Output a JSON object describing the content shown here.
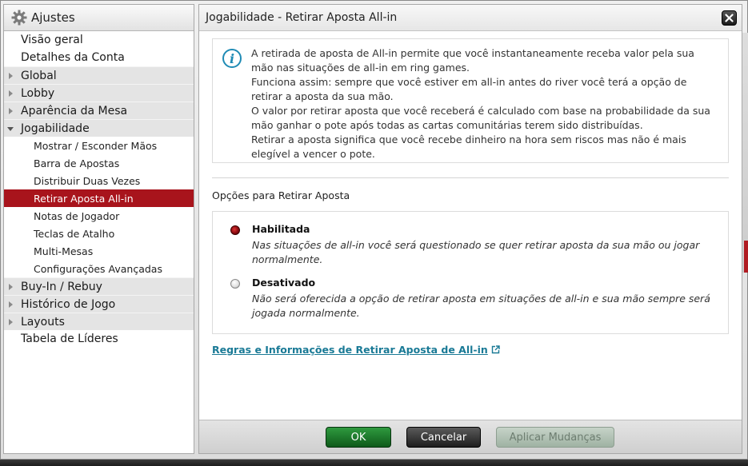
{
  "sidebar": {
    "title": "Ajustes",
    "items": [
      {
        "label": "Visão geral"
      },
      {
        "label": "Detalhes da Conta"
      },
      {
        "label": "Global"
      },
      {
        "label": "Lobby"
      },
      {
        "label": "Aparência da Mesa"
      },
      {
        "label": "Jogabilidade"
      },
      {
        "label": "Mostrar / Esconder Mãos"
      },
      {
        "label": "Barra de Apostas"
      },
      {
        "label": "Distribuir Duas Vezes"
      },
      {
        "label": "Retirar Aposta All-in"
      },
      {
        "label": "Notas de Jogador"
      },
      {
        "label": "Teclas de Atalho"
      },
      {
        "label": "Multi-Mesas"
      },
      {
        "label": "Configurações Avançadas"
      },
      {
        "label": "Buy-In / Rebuy"
      },
      {
        "label": "Histórico de Jogo"
      },
      {
        "label": "Layouts"
      },
      {
        "label": "Tabela de Líderes"
      }
    ]
  },
  "panel": {
    "title": "Jogabilidade - Retirar Aposta All-in",
    "info_lines": [
      "A retirada de aposta de All-in permite que você instantaneamente receba valor pela sua mão nas situações de all-in em ring games.",
      "Funciona assim: sempre que você estiver em all-in antes do river você terá a opção de retirar a aposta da sua mão.",
      "O valor por retirar aposta que você receberá é calculado com base na probabilidade da sua mão ganhar o pote após todas as cartas comunitárias terem sido distribuídas.",
      "Retirar a aposta significa que você recebe dinheiro na hora sem riscos mas não é mais elegível a vencer o pote."
    ],
    "section_title": "Opções para Retirar Aposta",
    "options": [
      {
        "label": "Habilitada",
        "description": "Nas situações de all-in você será questionado se quer retirar aposta da sua mão ou jogar normalmente.",
        "selected": true
      },
      {
        "label": "Desativado",
        "description": "Não será oferecida a opção de retirar aposta em situações de all-in e sua mão sempre será jogada normalmente.",
        "selected": false
      }
    ],
    "rules_link": "Regras e Informações de Retirar Aposta de All-in"
  },
  "footer": {
    "ok_label": "OK",
    "cancel_label": "Cancelar",
    "apply_label": "Aplicar Mudanças"
  },
  "colors": {
    "selected_bg": "#a8141c",
    "ok_button": "#1f7a2f",
    "link": "#1a7a96",
    "info_icon": "#1f8bb5"
  }
}
